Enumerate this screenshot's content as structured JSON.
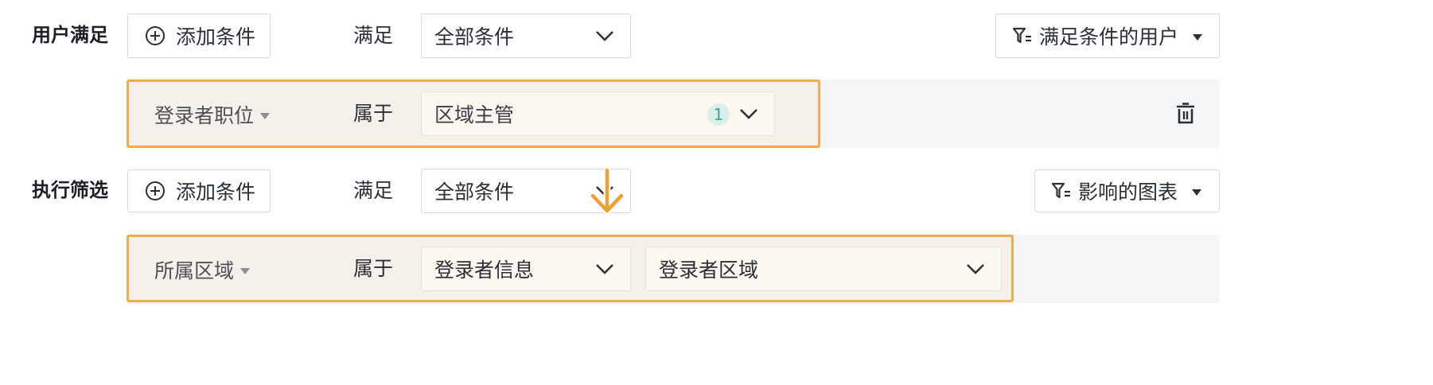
{
  "user_section": {
    "label": "用户满足",
    "add_condition_label": "添加条件",
    "match_label": "满足",
    "match_value": "全部条件",
    "filter_dropdown_label": "满足条件的用户",
    "condition": {
      "field": "登录者职位",
      "operator": "属于",
      "value": "区域主管",
      "count": "1"
    }
  },
  "filter_section": {
    "label": "执行筛选",
    "add_condition_label": "添加条件",
    "match_label": "满足",
    "match_value": "全部条件",
    "filter_dropdown_label": "影响的图表",
    "condition": {
      "field": "所属区域",
      "operator": "属于",
      "value_source": "登录者信息",
      "value_field": "登录者区域"
    }
  },
  "icons": {
    "add": "plus-circle-icon",
    "filter": "filter-icon",
    "delete": "trash-icon",
    "chevron": "chevron-down-icon",
    "caret": "caret-down-icon",
    "drag_cursor": "down-arrow-cursor-icon"
  },
  "colors": {
    "highlight_border": "#f0ad4e",
    "highlight_fill": "#f5f1ea",
    "row_background": "#f5f6f8",
    "badge_bg": "#dceee9",
    "badge_text": "#3aa79a"
  }
}
